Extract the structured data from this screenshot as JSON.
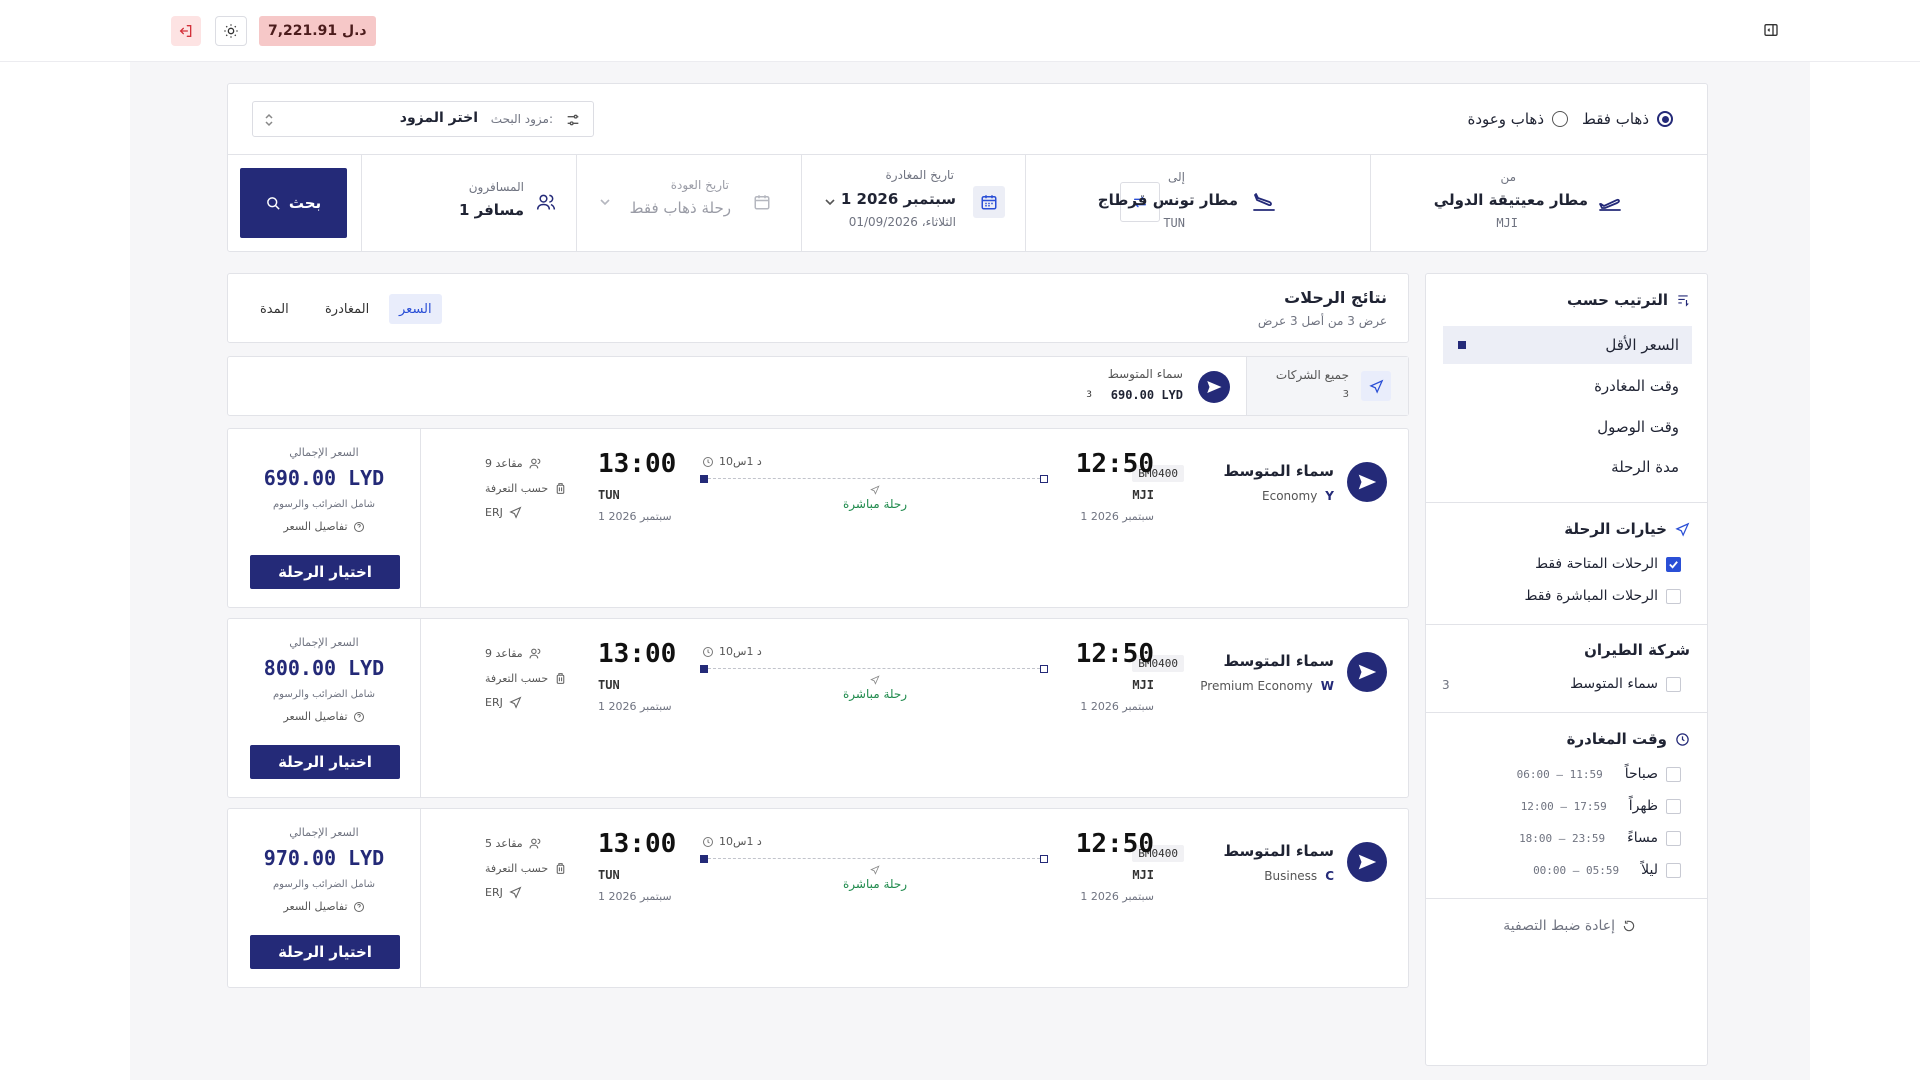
{
  "topbar": {
    "balance": "7,221.91 د.ل"
  },
  "trip_type": {
    "one_way": "ذهاب فقط",
    "round_trip": "ذهاب وعودة",
    "selected": "one_way"
  },
  "provider": {
    "label": "مزود البحث:",
    "value": "اختر المزود"
  },
  "origin": {
    "label": "من",
    "name": "مطار معيتيقة الدولي",
    "code": "MJI"
  },
  "destination": {
    "label": "إلى",
    "name": "مطار تونس قرطاج",
    "code": "TUN"
  },
  "departure": {
    "label": "تاريخ المغادرة",
    "date": "1 سبتمبر 2026",
    "sub": "الثلاثاء، 01/09/2026"
  },
  "return": {
    "label": "تاريخ العودة",
    "placeholder": "رحلة ذهاب فقط"
  },
  "passengers": {
    "label": "المسافرون",
    "value": "1 مسافر"
  },
  "search_button": "بحث",
  "results": {
    "title": "نتائج الرحلات",
    "subtitle": "عرض 3 من أصل 3 عرض",
    "tabs": [
      {
        "label": "السعر",
        "active": true
      },
      {
        "label": "المغادرة",
        "active": false
      },
      {
        "label": "المدة",
        "active": false
      }
    ]
  },
  "airline_strip": {
    "all_label": "جميع الشركات",
    "all_count": "3",
    "airline_name": "سماء المتوسط",
    "airline_price": "690.00 LYD",
    "airline_count": "3"
  },
  "sort": {
    "title": "الترتيب حسب",
    "items": [
      "السعر الأقل",
      "وقت المغادرة",
      "وقت الوصول",
      "مدة الرحلة"
    ],
    "active_index": 0
  },
  "options": {
    "title": "خيارات الرحلة",
    "items": [
      {
        "label": "الرحلات المتاحة فقط",
        "checked": true
      },
      {
        "label": "الرحلات المباشرة فقط",
        "checked": false
      }
    ]
  },
  "airlines_filter": {
    "title": "شركة الطيران",
    "items": [
      {
        "label": "سماء المتوسط",
        "count": "3",
        "checked": false
      }
    ]
  },
  "departure_time": {
    "title": "وقت المغادرة",
    "items": [
      {
        "label": "صباحاً",
        "range": "06:00 – 11:59"
      },
      {
        "label": "ظهراً",
        "range": "12:00 – 17:59"
      },
      {
        "label": "مساءً",
        "range": "18:00 – 23:59"
      },
      {
        "label": "ليلاً",
        "range": "00:00 – 05:59"
      }
    ]
  },
  "reset_filters": "إعادة ضبط التصفية",
  "flights": [
    {
      "airline": "سماء المتوسط",
      "flight_no": "BM0400",
      "cabin": "Economy",
      "class_code": "Y",
      "dep_time": "12:50",
      "dep_code": "MJI",
      "dep_date": "1 سبتمبر 2026",
      "arr_time": "13:00",
      "arr_code": "TUN",
      "arr_date": "1 سبتمبر 2026",
      "duration": "10د 1س",
      "stops": "رحلة مباشرة",
      "seats": "9 مقاعد",
      "baggage": "حسب التعرفة",
      "aircraft": "ERJ",
      "price_label": "السعر الإجمالي",
      "price": "690.00 LYD",
      "taxes": "شامل الضرائب والرسوم",
      "details": "تفاصيل السعر",
      "select": "اختيار الرحلة"
    },
    {
      "airline": "سماء المتوسط",
      "flight_no": "BM0400",
      "cabin": "Premium Economy",
      "class_code": "W",
      "dep_time": "12:50",
      "dep_code": "MJI",
      "dep_date": "1 سبتمبر 2026",
      "arr_time": "13:00",
      "arr_code": "TUN",
      "arr_date": "1 سبتمبر 2026",
      "duration": "10د 1س",
      "stops": "رحلة مباشرة",
      "seats": "9 مقاعد",
      "baggage": "حسب التعرفة",
      "aircraft": "ERJ",
      "price_label": "السعر الإجمالي",
      "price": "800.00 LYD",
      "taxes": "شامل الضرائب والرسوم",
      "details": "تفاصيل السعر",
      "select": "اختيار الرحلة"
    },
    {
      "airline": "سماء المتوسط",
      "flight_no": "BM0400",
      "cabin": "Business",
      "class_code": "C",
      "dep_time": "12:50",
      "dep_code": "MJI",
      "dep_date": "1 سبتمبر 2026",
      "arr_time": "13:00",
      "arr_code": "TUN",
      "arr_date": "1 سبتمبر 2026",
      "duration": "10د 1س",
      "stops": "رحلة مباشرة",
      "seats": "5 مقاعد",
      "baggage": "حسب التعرفة",
      "aircraft": "ERJ",
      "price_label": "السعر الإجمالي",
      "price": "970.00 LYD",
      "taxes": "شامل الضرائب والرسوم",
      "details": "تفاصيل السعر",
      "select": "اختيار الرحلة"
    }
  ],
  "colors": {
    "primary": "#242a78",
    "accent_blue": "#2a4fd6",
    "success": "#1f8a4c",
    "danger_bg": "#f6c8c8"
  }
}
